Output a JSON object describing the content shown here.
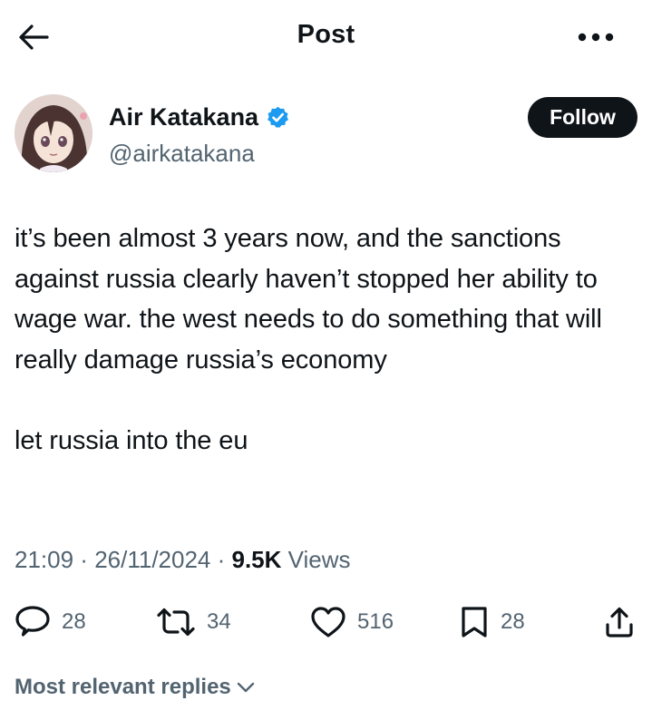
{
  "header": {
    "title": "Post",
    "back_icon": "arrow-left-icon",
    "more_icon": "more-dots-icon"
  },
  "author": {
    "display_name": "Air Katakana",
    "handle": "@airkatakana",
    "verified": true,
    "verified_icon": "verified-badge-icon",
    "follow_label": "Follow"
  },
  "post": {
    "text": "it’s been almost 3 years now, and the sanctions against russia clearly haven’t stopped her ability to wage war. the west needs to do something that will really damage russia’s economy\n\nlet russia into the eu",
    "time": "21:09",
    "date": "26/11/2024",
    "views_count": "9.5K",
    "views_label": "Views"
  },
  "actions": {
    "replies": "28",
    "reposts": "34",
    "likes": "516",
    "bookmarks": "28"
  },
  "replies_sort": {
    "label": "Most relevant replies"
  },
  "colors": {
    "text_primary": "#0f1419",
    "text_secondary": "#536471",
    "verified_blue": "#1d9bf0",
    "follow_bg": "#0f1419"
  }
}
